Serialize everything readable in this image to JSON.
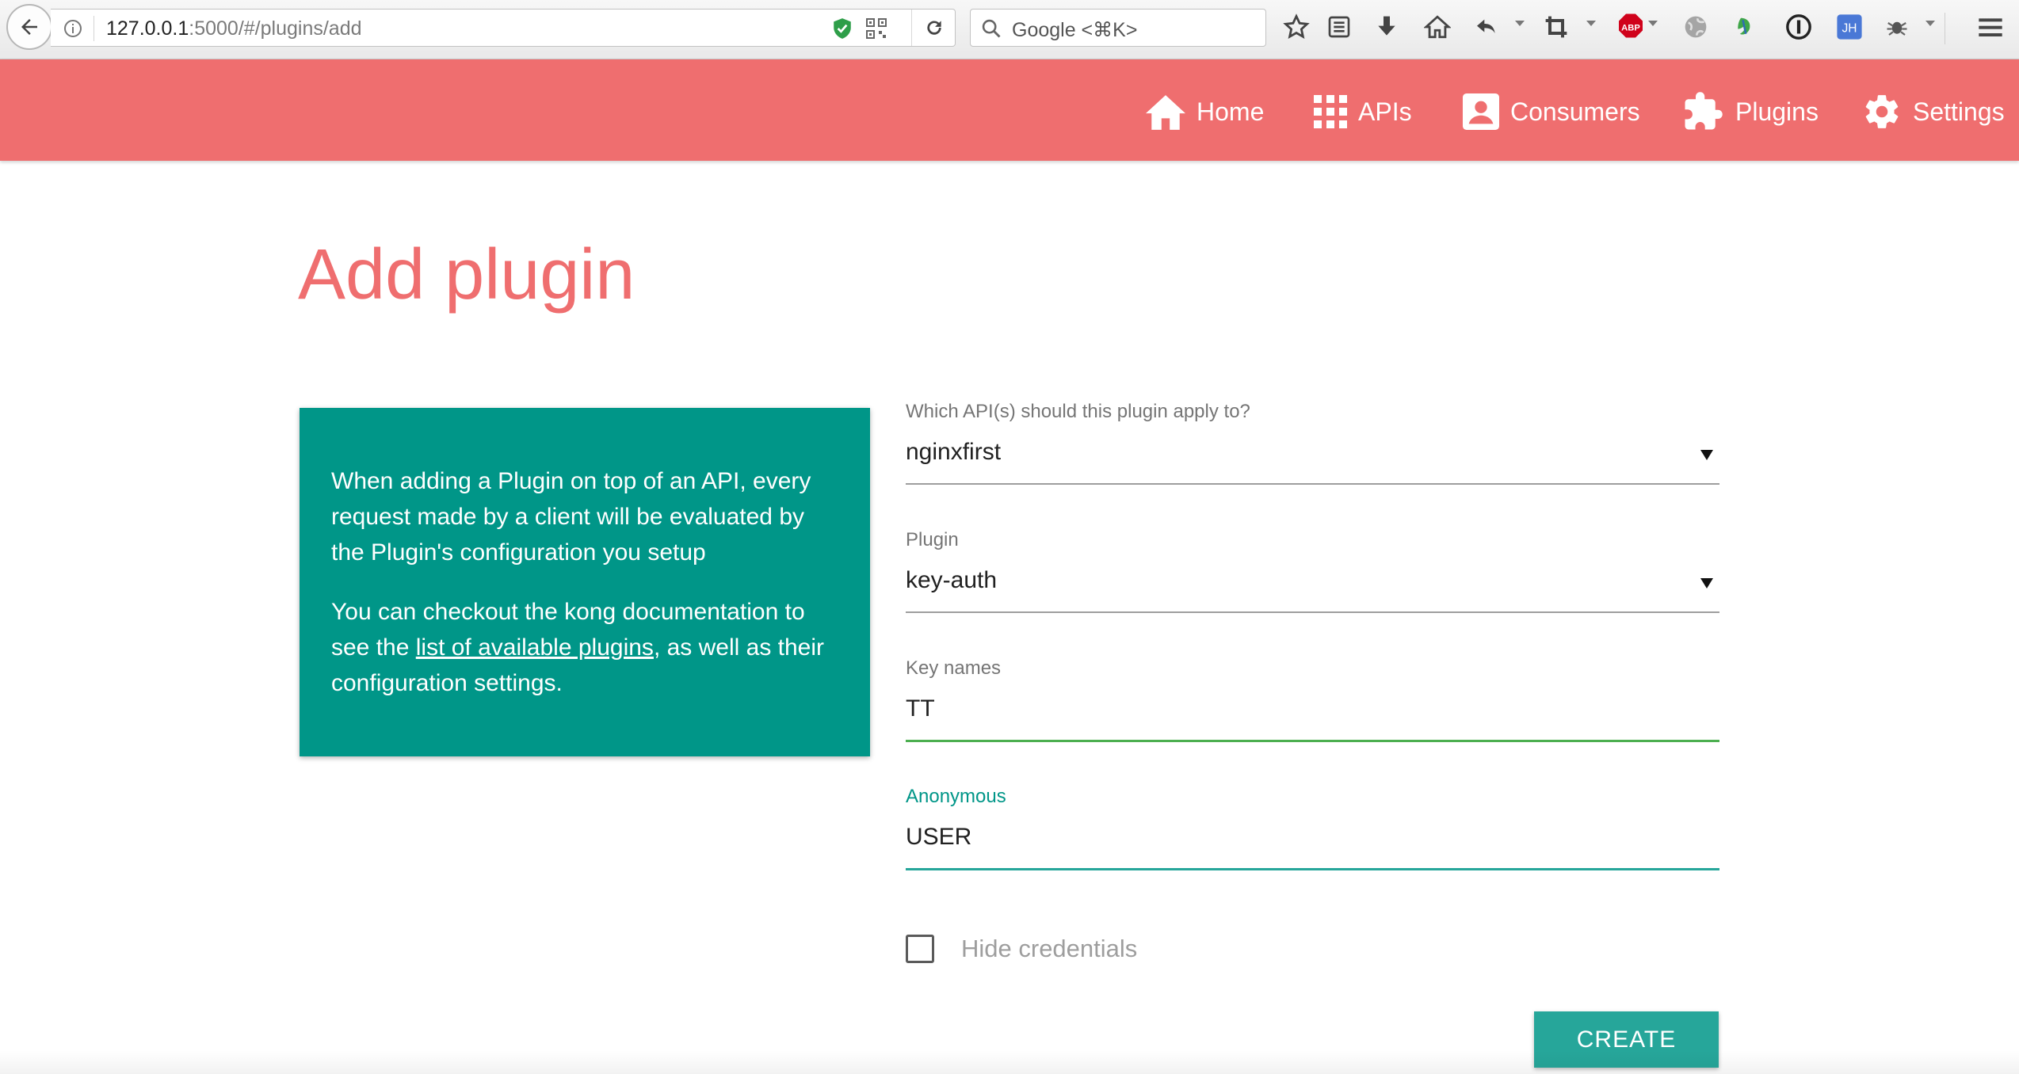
{
  "browser": {
    "url_host": "127.0.0.1",
    "url_rest": ":5000/#/plugins/add",
    "search_placeholder": "Google <⌘K>",
    "toolbar_icons": [
      "bookmark-star-icon",
      "reading-list-icon",
      "download-icon",
      "home-icon",
      "undo-icon",
      "crop-icon",
      "adblock-icon",
      "globe-icon",
      "leaf-icon",
      "password-icon",
      "jh-extension-icon",
      "bug-icon",
      "menu-icon"
    ],
    "adblock_label": "ABP",
    "ext_label": "JH"
  },
  "header": {
    "color": "#ef6e6f",
    "nav": [
      {
        "label": "Home",
        "icon": "home-icon"
      },
      {
        "label": "APIs",
        "icon": "grid-icon"
      },
      {
        "label": "Consumers",
        "icon": "person-icon"
      },
      {
        "label": "Plugins",
        "icon": "puzzle-icon"
      },
      {
        "label": "Settings",
        "icon": "gear-icon"
      }
    ]
  },
  "page": {
    "title": "Add plugin"
  },
  "info_card": {
    "color": "#009688",
    "paragraph1": "When adding a Plugin on top of an API, every request made by a client will be evaluated by the Plugin's configuration you setup",
    "paragraph2_before": "You can checkout the kong documentation to see the ",
    "paragraph2_link": "list of available plugins",
    "paragraph2_after": ", as well as their configuration settings."
  },
  "form": {
    "api_field": {
      "label": "Which API(s) should this plugin apply to?",
      "value": "nginxfirst"
    },
    "plugin_field": {
      "label": "Plugin",
      "value": "key-auth"
    },
    "key_names_field": {
      "label": "Key names",
      "value": "TT"
    },
    "anonymous_field": {
      "label": "Anonymous",
      "value": "USER"
    },
    "hide_credentials": {
      "label": "Hide credentials",
      "checked": false
    },
    "submit_label": "CREATE"
  }
}
